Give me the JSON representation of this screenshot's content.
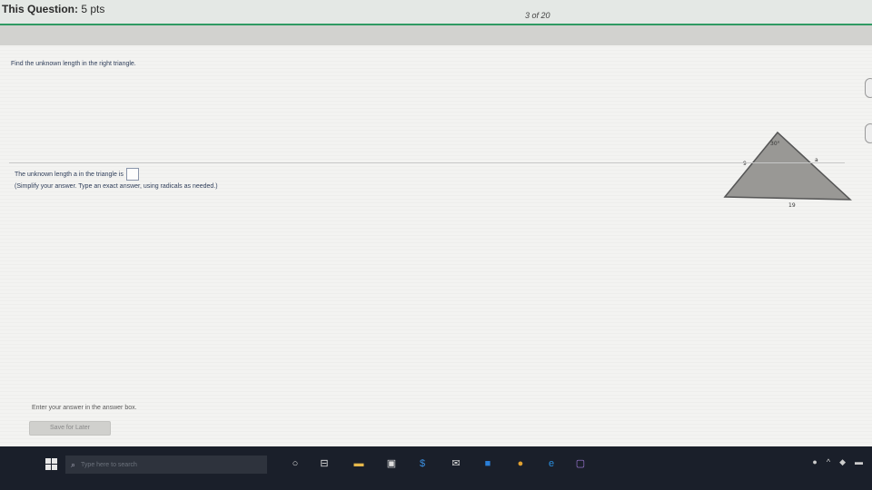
{
  "header": {
    "question_label": "This Question:",
    "points": "5 pts",
    "counter": "3 of 20"
  },
  "prompt": "Find the unknown length in the right triangle.",
  "figure": {
    "angle_label": "30°",
    "left_side_label": "9",
    "right_side_label": "a",
    "base_label": "19"
  },
  "answer": {
    "line_text": "The unknown length a in the triangle is",
    "value": "",
    "hint": "(Simplify your answer. Type an exact answer, using radicals as needed.)"
  },
  "footer": {
    "instruction": "Enter your answer in the answer box.",
    "save_label": "Save for Later"
  },
  "taskbar": {
    "search_placeholder": "Type here to search",
    "search_icon": "search-icon",
    "icons": [
      "windows-icon",
      "cortana-icon",
      "task-view-icon",
      "file-explorer-icon",
      "store-icon",
      "stock-icon",
      "notification-icon",
      "chrome-icon",
      "edge-icon",
      "premiere-icon"
    ],
    "tray_icons": [
      "chrome-tray-icon",
      "chevron-up-icon",
      "network-icon",
      "volume-icon"
    ]
  },
  "colors": {
    "accent": "#2f9a63",
    "taskbar": "#1a1f2a",
    "triangle_fill": "#999895"
  }
}
